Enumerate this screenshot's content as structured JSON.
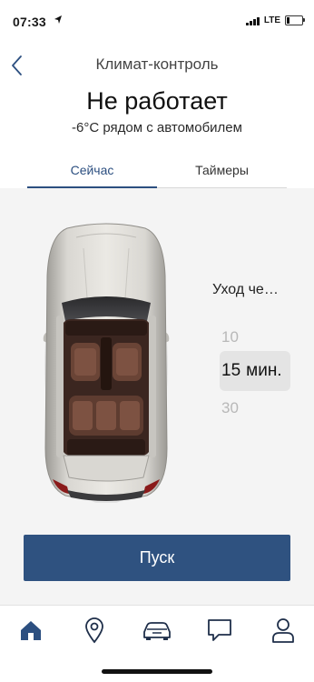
{
  "status_bar": {
    "time": "07:33",
    "network": "LTE",
    "battery_level": 0.2,
    "icons": [
      "location-arrow-icon",
      "signal-icon",
      "battery-icon"
    ]
  },
  "header": {
    "title": "Климат-контроль",
    "back_icon": "chevron-left-icon"
  },
  "climate": {
    "status": "Не работает",
    "temperature": "-6°C рядом с автомобилем"
  },
  "tabs": [
    {
      "label": "Сейчас",
      "active": true
    },
    {
      "label": "Таймеры",
      "active": false
    }
  ],
  "departure_picker": {
    "label": "Уход че…",
    "above_value": "10",
    "selected_value": "15",
    "selected_unit": "мин.",
    "below_value": "30"
  },
  "start_button": {
    "label": "Пуск"
  },
  "bottom_nav": [
    {
      "icon": "home-icon",
      "active": true
    },
    {
      "icon": "location-pin-icon",
      "active": false
    },
    {
      "icon": "car-icon",
      "active": false
    },
    {
      "icon": "chat-icon",
      "active": false
    },
    {
      "icon": "profile-icon",
      "active": false
    }
  ],
  "colors": {
    "accent": "#2f5280",
    "tab_active": "#2c4f80",
    "nav_icon": "#1f2f4a",
    "car_body": "#cdcbc5",
    "interior": "#4a3128"
  }
}
